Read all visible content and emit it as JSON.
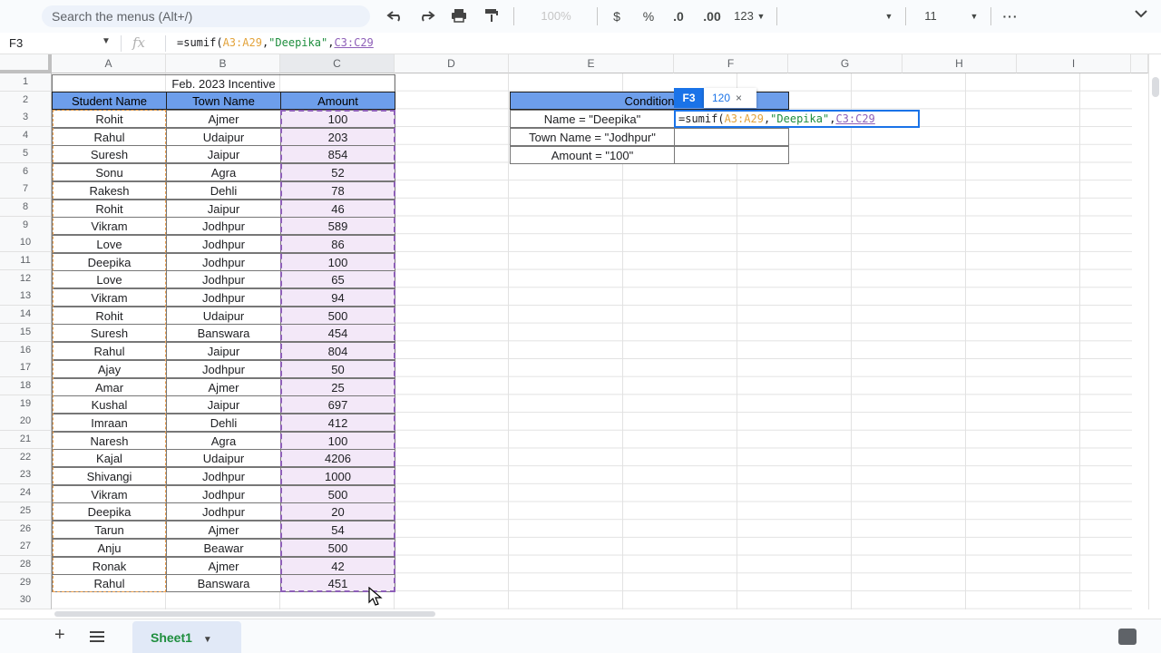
{
  "toolbar": {
    "search_placeholder": "Search the menus (Alt+/)",
    "zoom": "100%",
    "currency": "$",
    "percent": "%",
    "dec_decrease": ".0",
    "dec_increase": ".00",
    "format_more": "123",
    "font_size": "11"
  },
  "formula_bar": {
    "cell_ref": "F3",
    "fx_label": "fx",
    "formula_prefix": "=sumif(",
    "formula_range1": "A3:A29",
    "formula_comma1": ",",
    "formula_criterion": "\"Deepika\"",
    "formula_comma2": ",",
    "formula_range2": "C3:C29"
  },
  "columns": [
    "A",
    "B",
    "C",
    "D",
    "E",
    "F",
    "G",
    "H",
    "I"
  ],
  "rows": [
    "1",
    "2",
    "3",
    "4",
    "5",
    "6",
    "7",
    "8",
    "9",
    "10",
    "11",
    "12",
    "13",
    "14",
    "15",
    "16",
    "17",
    "18",
    "19",
    "20",
    "21",
    "22",
    "23",
    "24",
    "25",
    "26",
    "27",
    "28",
    "29",
    "30"
  ],
  "sheet_title": "Feb. 2023 Incentive",
  "table": {
    "headers": [
      "Student Name",
      "Town Name",
      "Amount"
    ],
    "rows": [
      [
        "Rohit",
        "Ajmer",
        "100"
      ],
      [
        "Rahul",
        "Udaipur",
        "203"
      ],
      [
        "Suresh",
        "Jaipur",
        "854"
      ],
      [
        "Sonu",
        "Agra",
        "52"
      ],
      [
        "Rakesh",
        "Dehli",
        "78"
      ],
      [
        "Rohit",
        "Jaipur",
        "46"
      ],
      [
        "Vikram",
        "Jodhpur",
        "589"
      ],
      [
        "Love",
        "Jodhpur",
        "86"
      ],
      [
        "Deepika",
        "Jodhpur",
        "100"
      ],
      [
        "Love",
        "Jodhpur",
        "65"
      ],
      [
        "Vikram",
        "Jodhpur",
        "94"
      ],
      [
        "Rohit",
        "Udaipur",
        "500"
      ],
      [
        "Suresh",
        "Banswara",
        "454"
      ],
      [
        "Rahul",
        "Jaipur",
        "804"
      ],
      [
        "Ajay",
        "Jodhpur",
        "50"
      ],
      [
        "Amar",
        "Ajmer",
        "25"
      ],
      [
        "Kushal",
        "Jaipur",
        "697"
      ],
      [
        "Imraan",
        "Dehli",
        "412"
      ],
      [
        "Naresh",
        "Agra",
        "100"
      ],
      [
        "Kajal",
        "Udaipur",
        "4206"
      ],
      [
        "Shivangi",
        "Jodhpur",
        "1000"
      ],
      [
        "Vikram",
        "Jodhpur",
        "500"
      ],
      [
        "Deepika",
        "Jodhpur",
        "20"
      ],
      [
        "Tarun",
        "Ajmer",
        "54"
      ],
      [
        "Anju",
        "Beawar",
        "500"
      ],
      [
        "Ronak",
        "Ajmer",
        "42"
      ],
      [
        "Rahul",
        "Banswara",
        "451"
      ]
    ]
  },
  "condition": {
    "header": "Condition",
    "items": [
      "Name = \"Deepika\"",
      "Town Name = \"Jodhpur\"",
      "Amount = \"100\""
    ]
  },
  "edit": {
    "cell_tag": "F3",
    "preview_value": "120",
    "close": "×"
  },
  "sheet_tab": "Sheet1",
  "colors": {
    "header_fill": "#6d9eeb",
    "amount_fill": "#f3e8f8",
    "accent": "#1a73e8",
    "range_a": "#f0a04b",
    "range_c": "#8e5fb8"
  }
}
